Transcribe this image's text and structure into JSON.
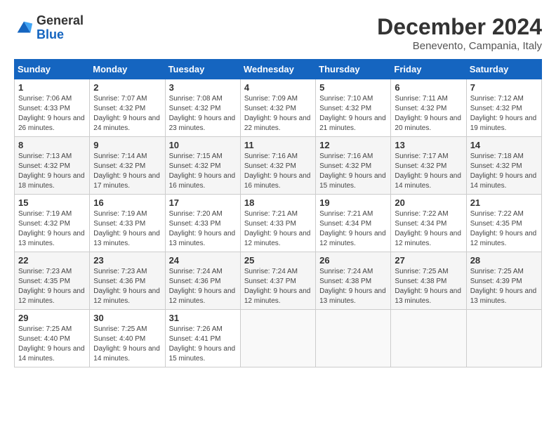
{
  "header": {
    "logo_general": "General",
    "logo_blue": "Blue",
    "title": "December 2024",
    "location": "Benevento, Campania, Italy"
  },
  "days_of_week": [
    "Sunday",
    "Monday",
    "Tuesday",
    "Wednesday",
    "Thursday",
    "Friday",
    "Saturday"
  ],
  "weeks": [
    [
      {
        "day": "1",
        "sunrise": "Sunrise: 7:06 AM",
        "sunset": "Sunset: 4:33 PM",
        "daylight": "Daylight: 9 hours and 26 minutes."
      },
      {
        "day": "2",
        "sunrise": "Sunrise: 7:07 AM",
        "sunset": "Sunset: 4:32 PM",
        "daylight": "Daylight: 9 hours and 24 minutes."
      },
      {
        "day": "3",
        "sunrise": "Sunrise: 7:08 AM",
        "sunset": "Sunset: 4:32 PM",
        "daylight": "Daylight: 9 hours and 23 minutes."
      },
      {
        "day": "4",
        "sunrise": "Sunrise: 7:09 AM",
        "sunset": "Sunset: 4:32 PM",
        "daylight": "Daylight: 9 hours and 22 minutes."
      },
      {
        "day": "5",
        "sunrise": "Sunrise: 7:10 AM",
        "sunset": "Sunset: 4:32 PM",
        "daylight": "Daylight: 9 hours and 21 minutes."
      },
      {
        "day": "6",
        "sunrise": "Sunrise: 7:11 AM",
        "sunset": "Sunset: 4:32 PM",
        "daylight": "Daylight: 9 hours and 20 minutes."
      },
      {
        "day": "7",
        "sunrise": "Sunrise: 7:12 AM",
        "sunset": "Sunset: 4:32 PM",
        "daylight": "Daylight: 9 hours and 19 minutes."
      }
    ],
    [
      {
        "day": "8",
        "sunrise": "Sunrise: 7:13 AM",
        "sunset": "Sunset: 4:32 PM",
        "daylight": "Daylight: 9 hours and 18 minutes."
      },
      {
        "day": "9",
        "sunrise": "Sunrise: 7:14 AM",
        "sunset": "Sunset: 4:32 PM",
        "daylight": "Daylight: 9 hours and 17 minutes."
      },
      {
        "day": "10",
        "sunrise": "Sunrise: 7:15 AM",
        "sunset": "Sunset: 4:32 PM",
        "daylight": "Daylight: 9 hours and 16 minutes."
      },
      {
        "day": "11",
        "sunrise": "Sunrise: 7:16 AM",
        "sunset": "Sunset: 4:32 PM",
        "daylight": "Daylight: 9 hours and 16 minutes."
      },
      {
        "day": "12",
        "sunrise": "Sunrise: 7:16 AM",
        "sunset": "Sunset: 4:32 PM",
        "daylight": "Daylight: 9 hours and 15 minutes."
      },
      {
        "day": "13",
        "sunrise": "Sunrise: 7:17 AM",
        "sunset": "Sunset: 4:32 PM",
        "daylight": "Daylight: 9 hours and 14 minutes."
      },
      {
        "day": "14",
        "sunrise": "Sunrise: 7:18 AM",
        "sunset": "Sunset: 4:32 PM",
        "daylight": "Daylight: 9 hours and 14 minutes."
      }
    ],
    [
      {
        "day": "15",
        "sunrise": "Sunrise: 7:19 AM",
        "sunset": "Sunset: 4:32 PM",
        "daylight": "Daylight: 9 hours and 13 minutes."
      },
      {
        "day": "16",
        "sunrise": "Sunrise: 7:19 AM",
        "sunset": "Sunset: 4:33 PM",
        "daylight": "Daylight: 9 hours and 13 minutes."
      },
      {
        "day": "17",
        "sunrise": "Sunrise: 7:20 AM",
        "sunset": "Sunset: 4:33 PM",
        "daylight": "Daylight: 9 hours and 13 minutes."
      },
      {
        "day": "18",
        "sunrise": "Sunrise: 7:21 AM",
        "sunset": "Sunset: 4:33 PM",
        "daylight": "Daylight: 9 hours and 12 minutes."
      },
      {
        "day": "19",
        "sunrise": "Sunrise: 7:21 AM",
        "sunset": "Sunset: 4:34 PM",
        "daylight": "Daylight: 9 hours and 12 minutes."
      },
      {
        "day": "20",
        "sunrise": "Sunrise: 7:22 AM",
        "sunset": "Sunset: 4:34 PM",
        "daylight": "Daylight: 9 hours and 12 minutes."
      },
      {
        "day": "21",
        "sunrise": "Sunrise: 7:22 AM",
        "sunset": "Sunset: 4:35 PM",
        "daylight": "Daylight: 9 hours and 12 minutes."
      }
    ],
    [
      {
        "day": "22",
        "sunrise": "Sunrise: 7:23 AM",
        "sunset": "Sunset: 4:35 PM",
        "daylight": "Daylight: 9 hours and 12 minutes."
      },
      {
        "day": "23",
        "sunrise": "Sunrise: 7:23 AM",
        "sunset": "Sunset: 4:36 PM",
        "daylight": "Daylight: 9 hours and 12 minutes."
      },
      {
        "day": "24",
        "sunrise": "Sunrise: 7:24 AM",
        "sunset": "Sunset: 4:36 PM",
        "daylight": "Daylight: 9 hours and 12 minutes."
      },
      {
        "day": "25",
        "sunrise": "Sunrise: 7:24 AM",
        "sunset": "Sunset: 4:37 PM",
        "daylight": "Daylight: 9 hours and 12 minutes."
      },
      {
        "day": "26",
        "sunrise": "Sunrise: 7:24 AM",
        "sunset": "Sunset: 4:38 PM",
        "daylight": "Daylight: 9 hours and 13 minutes."
      },
      {
        "day": "27",
        "sunrise": "Sunrise: 7:25 AM",
        "sunset": "Sunset: 4:38 PM",
        "daylight": "Daylight: 9 hours and 13 minutes."
      },
      {
        "day": "28",
        "sunrise": "Sunrise: 7:25 AM",
        "sunset": "Sunset: 4:39 PM",
        "daylight": "Daylight: 9 hours and 13 minutes."
      }
    ],
    [
      {
        "day": "29",
        "sunrise": "Sunrise: 7:25 AM",
        "sunset": "Sunset: 4:40 PM",
        "daylight": "Daylight: 9 hours and 14 minutes."
      },
      {
        "day": "30",
        "sunrise": "Sunrise: 7:25 AM",
        "sunset": "Sunset: 4:40 PM",
        "daylight": "Daylight: 9 hours and 14 minutes."
      },
      {
        "day": "31",
        "sunrise": "Sunrise: 7:26 AM",
        "sunset": "Sunset: 4:41 PM",
        "daylight": "Daylight: 9 hours and 15 minutes."
      },
      null,
      null,
      null,
      null
    ]
  ]
}
